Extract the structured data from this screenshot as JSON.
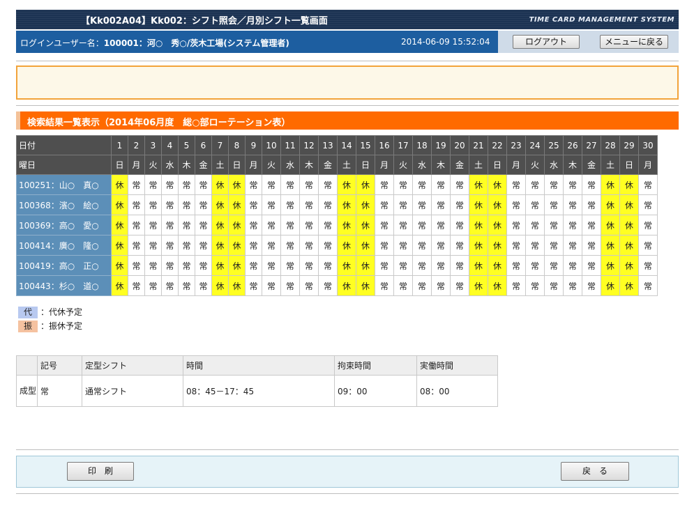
{
  "header": {
    "title": "【Kk002A04】Kk002：シフト照会／月別シフト一覧画面",
    "brand": "TIME CARD MANAGEMENT SYSTEM"
  },
  "userbar": {
    "label": "ログインユーザー名：",
    "user_id": "100001：",
    "user_name": "河○　秀○/茨木工場(システム管理者)",
    "timestamp": "2014-06-09 15:52:04",
    "logout_label": "ログアウト",
    "menu_label": "メニューに戻る"
  },
  "message": "",
  "section": {
    "title": "検索結果一覧表示（2014年06月度　総○部ローテーション表）"
  },
  "grid": {
    "date_header": "日付",
    "weekday_header": "曜日",
    "days": [
      "1",
      "2",
      "3",
      "4",
      "5",
      "6",
      "7",
      "8",
      "9",
      "10",
      "11",
      "12",
      "13",
      "14",
      "15",
      "16",
      "17",
      "18",
      "19",
      "20",
      "21",
      "22",
      "23",
      "24",
      "25",
      "26",
      "27",
      "28",
      "29",
      "30"
    ],
    "weekdays": [
      "日",
      "月",
      "火",
      "水",
      "木",
      "金",
      "土",
      "日",
      "月",
      "火",
      "水",
      "木",
      "金",
      "土",
      "日",
      "月",
      "火",
      "水",
      "木",
      "金",
      "土",
      "日",
      "月",
      "火",
      "水",
      "木",
      "金",
      "土",
      "日",
      "月"
    ],
    "rows": [
      {
        "name": "100251：山○　真○",
        "shifts": [
          "休",
          "常",
          "常",
          "常",
          "常",
          "常",
          "休",
          "休",
          "常",
          "常",
          "常",
          "常",
          "常",
          "休",
          "休",
          "常",
          "常",
          "常",
          "常",
          "常",
          "休",
          "休",
          "常",
          "常",
          "常",
          "常",
          "常",
          "休",
          "休",
          "常"
        ]
      },
      {
        "name": "100368：濱○　絵○",
        "shifts": [
          "休",
          "常",
          "常",
          "常",
          "常",
          "常",
          "休",
          "休",
          "常",
          "常",
          "常",
          "常",
          "常",
          "休",
          "休",
          "常",
          "常",
          "常",
          "常",
          "常",
          "休",
          "休",
          "常",
          "常",
          "常",
          "常",
          "常",
          "休",
          "休",
          "常"
        ]
      },
      {
        "name": "100369：高○　愛○",
        "shifts": [
          "休",
          "常",
          "常",
          "常",
          "常",
          "常",
          "休",
          "休",
          "常",
          "常",
          "常",
          "常",
          "常",
          "休",
          "休",
          "常",
          "常",
          "常",
          "常",
          "常",
          "休",
          "休",
          "常",
          "常",
          "常",
          "常",
          "常",
          "休",
          "休",
          "常"
        ]
      },
      {
        "name": "100414：廣○　隆○",
        "shifts": [
          "休",
          "常",
          "常",
          "常",
          "常",
          "常",
          "休",
          "休",
          "常",
          "常",
          "常",
          "常",
          "常",
          "休",
          "休",
          "常",
          "常",
          "常",
          "常",
          "常",
          "休",
          "休",
          "常",
          "常",
          "常",
          "常",
          "常",
          "休",
          "休",
          "常"
        ]
      },
      {
        "name": "100419：高○　正○",
        "shifts": [
          "休",
          "常",
          "常",
          "常",
          "常",
          "常",
          "休",
          "休",
          "常",
          "常",
          "常",
          "常",
          "常",
          "休",
          "休",
          "常",
          "常",
          "常",
          "常",
          "常",
          "休",
          "休",
          "常",
          "常",
          "常",
          "常",
          "常",
          "休",
          "休",
          "常"
        ]
      },
      {
        "name": "100443：杉○　道○",
        "shifts": [
          "休",
          "常",
          "常",
          "常",
          "常",
          "常",
          "休",
          "休",
          "常",
          "常",
          "常",
          "常",
          "常",
          "休",
          "休",
          "常",
          "常",
          "常",
          "常",
          "常",
          "休",
          "休",
          "常",
          "常",
          "常",
          "常",
          "常",
          "休",
          "休",
          "常"
        ]
      }
    ],
    "off_mark": "休",
    "colors": {
      "off": "#ffff22",
      "name_bg": "#5c8fb8",
      "header_bg": "#4f4f4f"
    }
  },
  "legend": [
    {
      "mark": "代",
      "text": "：代休予定",
      "color": "#b8c9f0"
    },
    {
      "mark": "振",
      "text": "：振休予定",
      "color": "#f5c2a0"
    }
  ],
  "shift_table": {
    "headers": [
      "",
      "記号",
      "定型シフト",
      "時間",
      "拘束時間",
      "実働時間"
    ],
    "row": {
      "group": "成型",
      "mark": "常",
      "shift": "通常シフト",
      "time": "08：45－17：45",
      "bind": "09：00",
      "work": "08：00"
    }
  },
  "footer": {
    "print_label": "印　刷",
    "back_label": "戻　る"
  }
}
